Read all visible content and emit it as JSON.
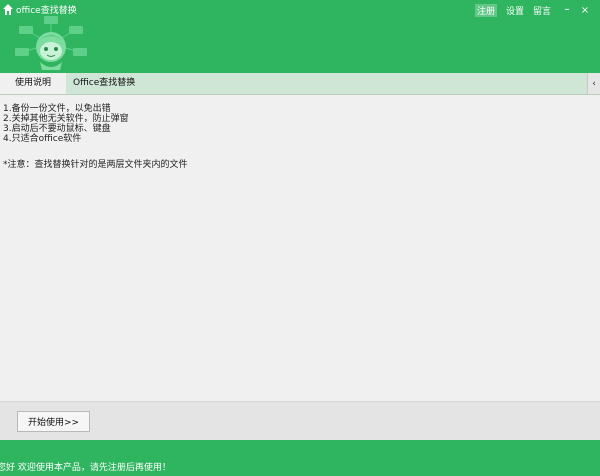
{
  "app": {
    "title": "office查找替换"
  },
  "topnav": {
    "register": "注册",
    "settings": "设置",
    "feedback": "留言",
    "minimize": "–",
    "close": "×"
  },
  "tabs": [
    {
      "label": "使用说明",
      "active": true
    },
    {
      "label": "Office查找替换",
      "active": false
    }
  ],
  "tab_scroll": "‹",
  "instructions": [
    "1.备份一份文件，以免出错",
    "2.关掉其他无关软件，防止弹窗",
    "3.启动后不要动鼠标、键盘",
    "4.只适合office软件"
  ],
  "note": "*注意：查找替换针对的是两层文件夹内的文件",
  "start_button": "开始使用>>",
  "status": "您好 欢迎使用本产品，请先注册后再使用！",
  "colors": {
    "brand": "#2fb460",
    "tab_bar": "#cfe6d6",
    "content_bg": "#f0f0f0"
  }
}
